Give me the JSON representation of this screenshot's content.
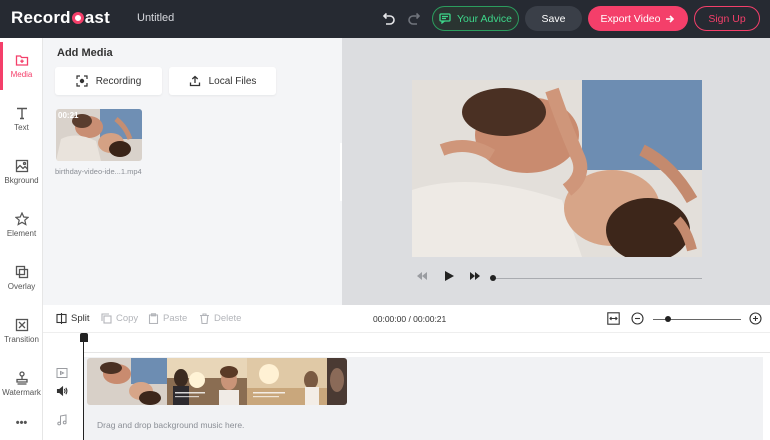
{
  "app": {
    "logo_text_left": "Record",
    "logo_text_right": "ast",
    "doc_title": "Untitled",
    "accent_color": "#f43f6a",
    "advice_color": "#3dd68a"
  },
  "header": {
    "advice_label": "Your Advice",
    "save_label": "Save",
    "export_label": "Export Video",
    "signup_label": "Sign Up"
  },
  "sidebar": {
    "items": [
      {
        "label": "Media",
        "icon": "media-icon"
      },
      {
        "label": "Text",
        "icon": "text-icon"
      },
      {
        "label": "Bkground",
        "icon": "background-icon"
      },
      {
        "label": "Element",
        "icon": "star-icon"
      },
      {
        "label": "Overlay",
        "icon": "overlay-icon"
      },
      {
        "label": "Transition",
        "icon": "transition-icon"
      },
      {
        "label": "Watermark",
        "icon": "watermark-icon"
      },
      {
        "label": "•••",
        "icon": "more-icon"
      }
    ]
  },
  "media": {
    "title": "Add Media",
    "recording_label": "Recording",
    "local_files_label": "Local Files",
    "file": {
      "duration": "00:21",
      "name": "birthday-video-ide...1.mp4"
    }
  },
  "timeline": {
    "split_label": "Split",
    "copy_label": "Copy",
    "paste_label": "Paste",
    "delete_label": "Delete",
    "time_display": "00:00:00 / 00:00:21",
    "music_hint": "Drag and drop background music here."
  }
}
